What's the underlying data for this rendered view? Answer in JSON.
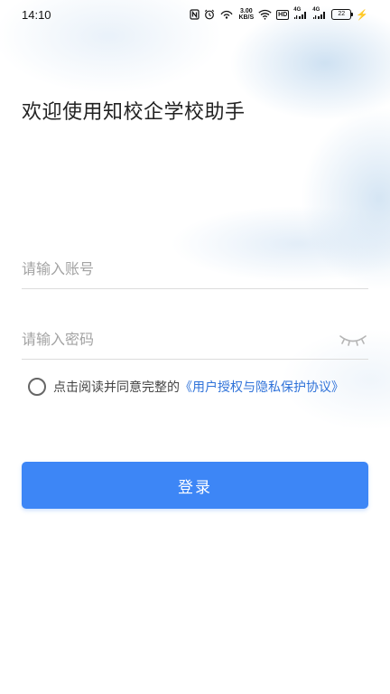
{
  "status_bar": {
    "time": "14:10",
    "net_speed_value": "3.00",
    "net_speed_unit": "KB/S",
    "network_1": "4G",
    "network_2": "4G",
    "hd_label": "HD",
    "battery_level": "22"
  },
  "page": {
    "title": "欢迎使用知校企学校助手"
  },
  "form": {
    "account_placeholder": "请输入账号",
    "account_value": "",
    "password_placeholder": "请输入密码",
    "password_value": ""
  },
  "agreement": {
    "checked": false,
    "text": "点击阅读并同意完整的",
    "link_text": "《用户授权与隐私保护协议》"
  },
  "login": {
    "label": "登录"
  },
  "colors": {
    "accent": "#3d86f6",
    "link": "#2f72d9",
    "placeholder": "#a3a3a3"
  }
}
